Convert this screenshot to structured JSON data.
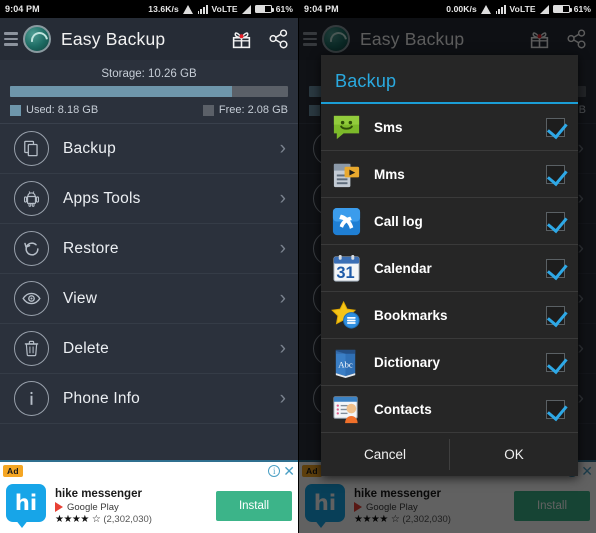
{
  "status_bar": {
    "time": "9:04 PM",
    "speed_left": "13.6K/s",
    "speed_right": "0.00K/s",
    "network": "VoLTE",
    "battery": "61%"
  },
  "app_bar": {
    "title": "Easy Backup",
    "menu_icon": "hamburger-icon",
    "logo_icon": "app-logo-icon",
    "gift_icon": "gift-icon",
    "share_icon": "share-icon"
  },
  "storage": {
    "title": "Storage: 10.26 GB",
    "used_label": "Used: 8.18 GB",
    "free_label": "Free: 2.08 GB",
    "used_percent": 80,
    "used_color": "#6e96ab",
    "free_color": "#5b6068"
  },
  "menu": {
    "items": [
      {
        "label": "Backup",
        "icon": "documents-copy-icon"
      },
      {
        "label": "Apps Tools",
        "icon": "android-robot-icon"
      },
      {
        "label": "Restore",
        "icon": "restore-arrow-icon"
      },
      {
        "label": "View",
        "icon": "eye-icon"
      },
      {
        "label": "Delete",
        "icon": "trash-icon"
      },
      {
        "label": "Phone Info",
        "icon": "info-icon"
      }
    ],
    "chevron": "›"
  },
  "ad": {
    "badge": "Ad",
    "info_icon": "info-circle-icon",
    "close_icon": "close-icon",
    "app_icon_text": "hi",
    "app_name": "hike messenger",
    "store": "Google Play",
    "stars": "★★★★",
    "half_star": "☆",
    "rating_count": "(2,302,030)",
    "install_label": "Install"
  },
  "dialog": {
    "title": "Backup",
    "accent": "#2aaae0",
    "items": [
      {
        "label": "Sms",
        "icon": "sms-bubble-icon",
        "checked": true
      },
      {
        "label": "Mms",
        "icon": "mms-media-icon",
        "checked": true
      },
      {
        "label": "Call log",
        "icon": "phone-call-icon",
        "checked": true
      },
      {
        "label": "Calendar",
        "icon": "calendar-31-icon",
        "checked": true
      },
      {
        "label": "Bookmarks",
        "icon": "star-bookmark-icon",
        "checked": true
      },
      {
        "label": "Dictionary",
        "icon": "dictionary-book-icon",
        "checked": true
      },
      {
        "label": "Contacts",
        "icon": "contacts-card-icon",
        "checked": true
      }
    ],
    "cancel_label": "Cancel",
    "ok_label": "OK"
  }
}
